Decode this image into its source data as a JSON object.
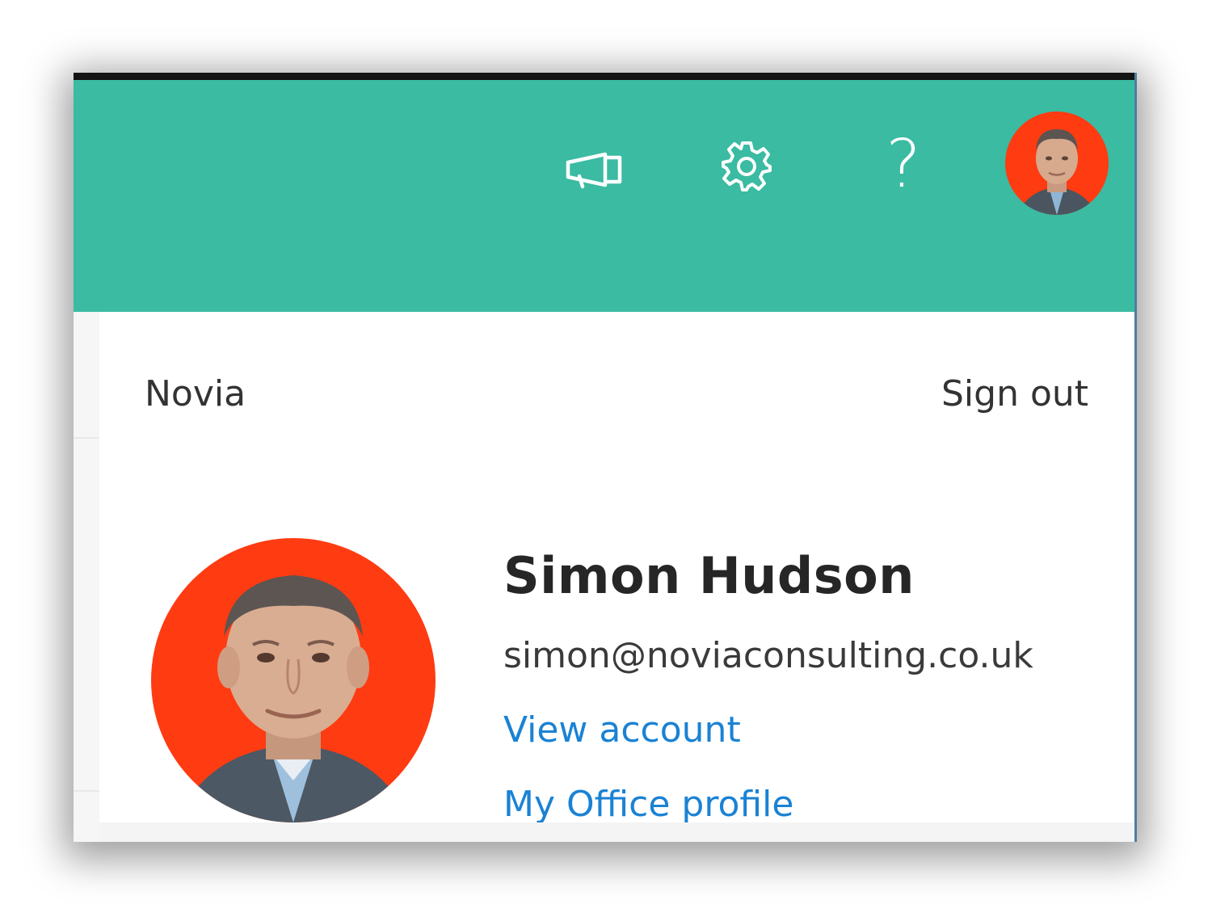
{
  "colors": {
    "header": "#3abba2",
    "link": "#1a82d4",
    "avatar_background": "#ff3b12"
  },
  "header": {
    "icons": [
      "megaphone-icon",
      "gear-icon",
      "help-icon",
      "avatar"
    ],
    "help_glyph": "?"
  },
  "account_panel": {
    "organization": "Novia",
    "sign_out_label": "Sign out",
    "user_name": "Simon Hudson",
    "email": "simon@noviaconsulting.co.uk",
    "view_account_label": "View account",
    "office_profile_label": "My Office profile"
  }
}
